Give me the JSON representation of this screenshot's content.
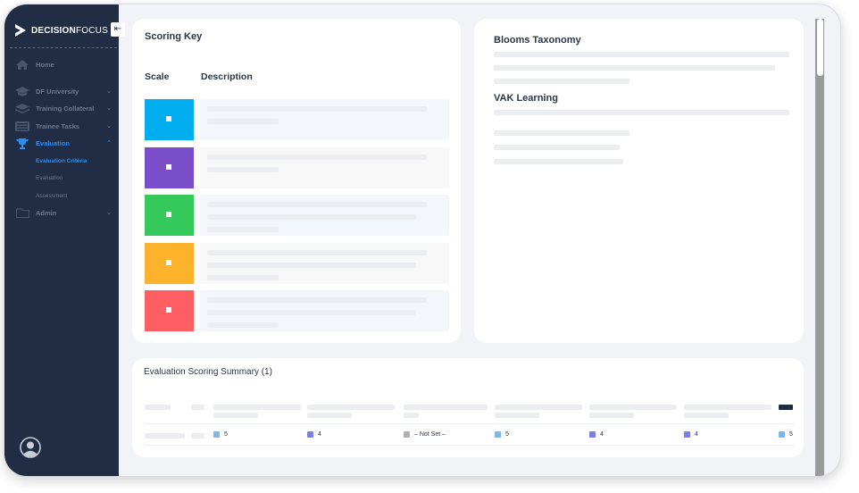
{
  "brand": {
    "name_bold": "DECISION",
    "name_light": "FOCUS"
  },
  "sidebar": {
    "items": [
      {
        "label": "Home",
        "icon": "home-icon"
      },
      {
        "label": "DF University",
        "icon": "graduation-cap-icon"
      },
      {
        "label": "Training Collateral",
        "icon": "layers-icon"
      },
      {
        "label": "Trainee Tasks",
        "icon": "tasks-icon"
      },
      {
        "label": "Evaluation",
        "icon": "trophy-icon"
      },
      {
        "label": "Admin",
        "icon": "folder-icon"
      }
    ],
    "evaluation_sub": [
      "Evaluation Criteria",
      "Evaluation",
      "Assessment"
    ]
  },
  "scoring_key": {
    "title": "Scoring Key",
    "col_scale": "Scale",
    "col_description": "Description",
    "scale_colors": [
      "#00aeef",
      "#7b4fc9",
      "#35c85a",
      "#fdb22b",
      "#ff5f63"
    ]
  },
  "taxonomy": {
    "blooms_title": "Blooms Taxonomy",
    "vak_title": "VAK Learning"
  },
  "summary": {
    "title": "Evaluation Scoring Summary (1)",
    "row": [
      {
        "value": "5",
        "color": "#7cb6ea"
      },
      {
        "value": "4",
        "color": "#7b7fe0"
      },
      {
        "value": "– Not Set –",
        "color": "#b0b0b0"
      },
      {
        "value": "5",
        "color": "#7cb6ea"
      },
      {
        "value": "4",
        "color": "#7b7fe0"
      },
      {
        "value": "4",
        "color": "#7b7fe0"
      },
      {
        "value": "5",
        "color": "#7cb6ea"
      }
    ]
  },
  "colors": {
    "sidebar_bg": "#212d45",
    "accent": "#2a8df2"
  }
}
